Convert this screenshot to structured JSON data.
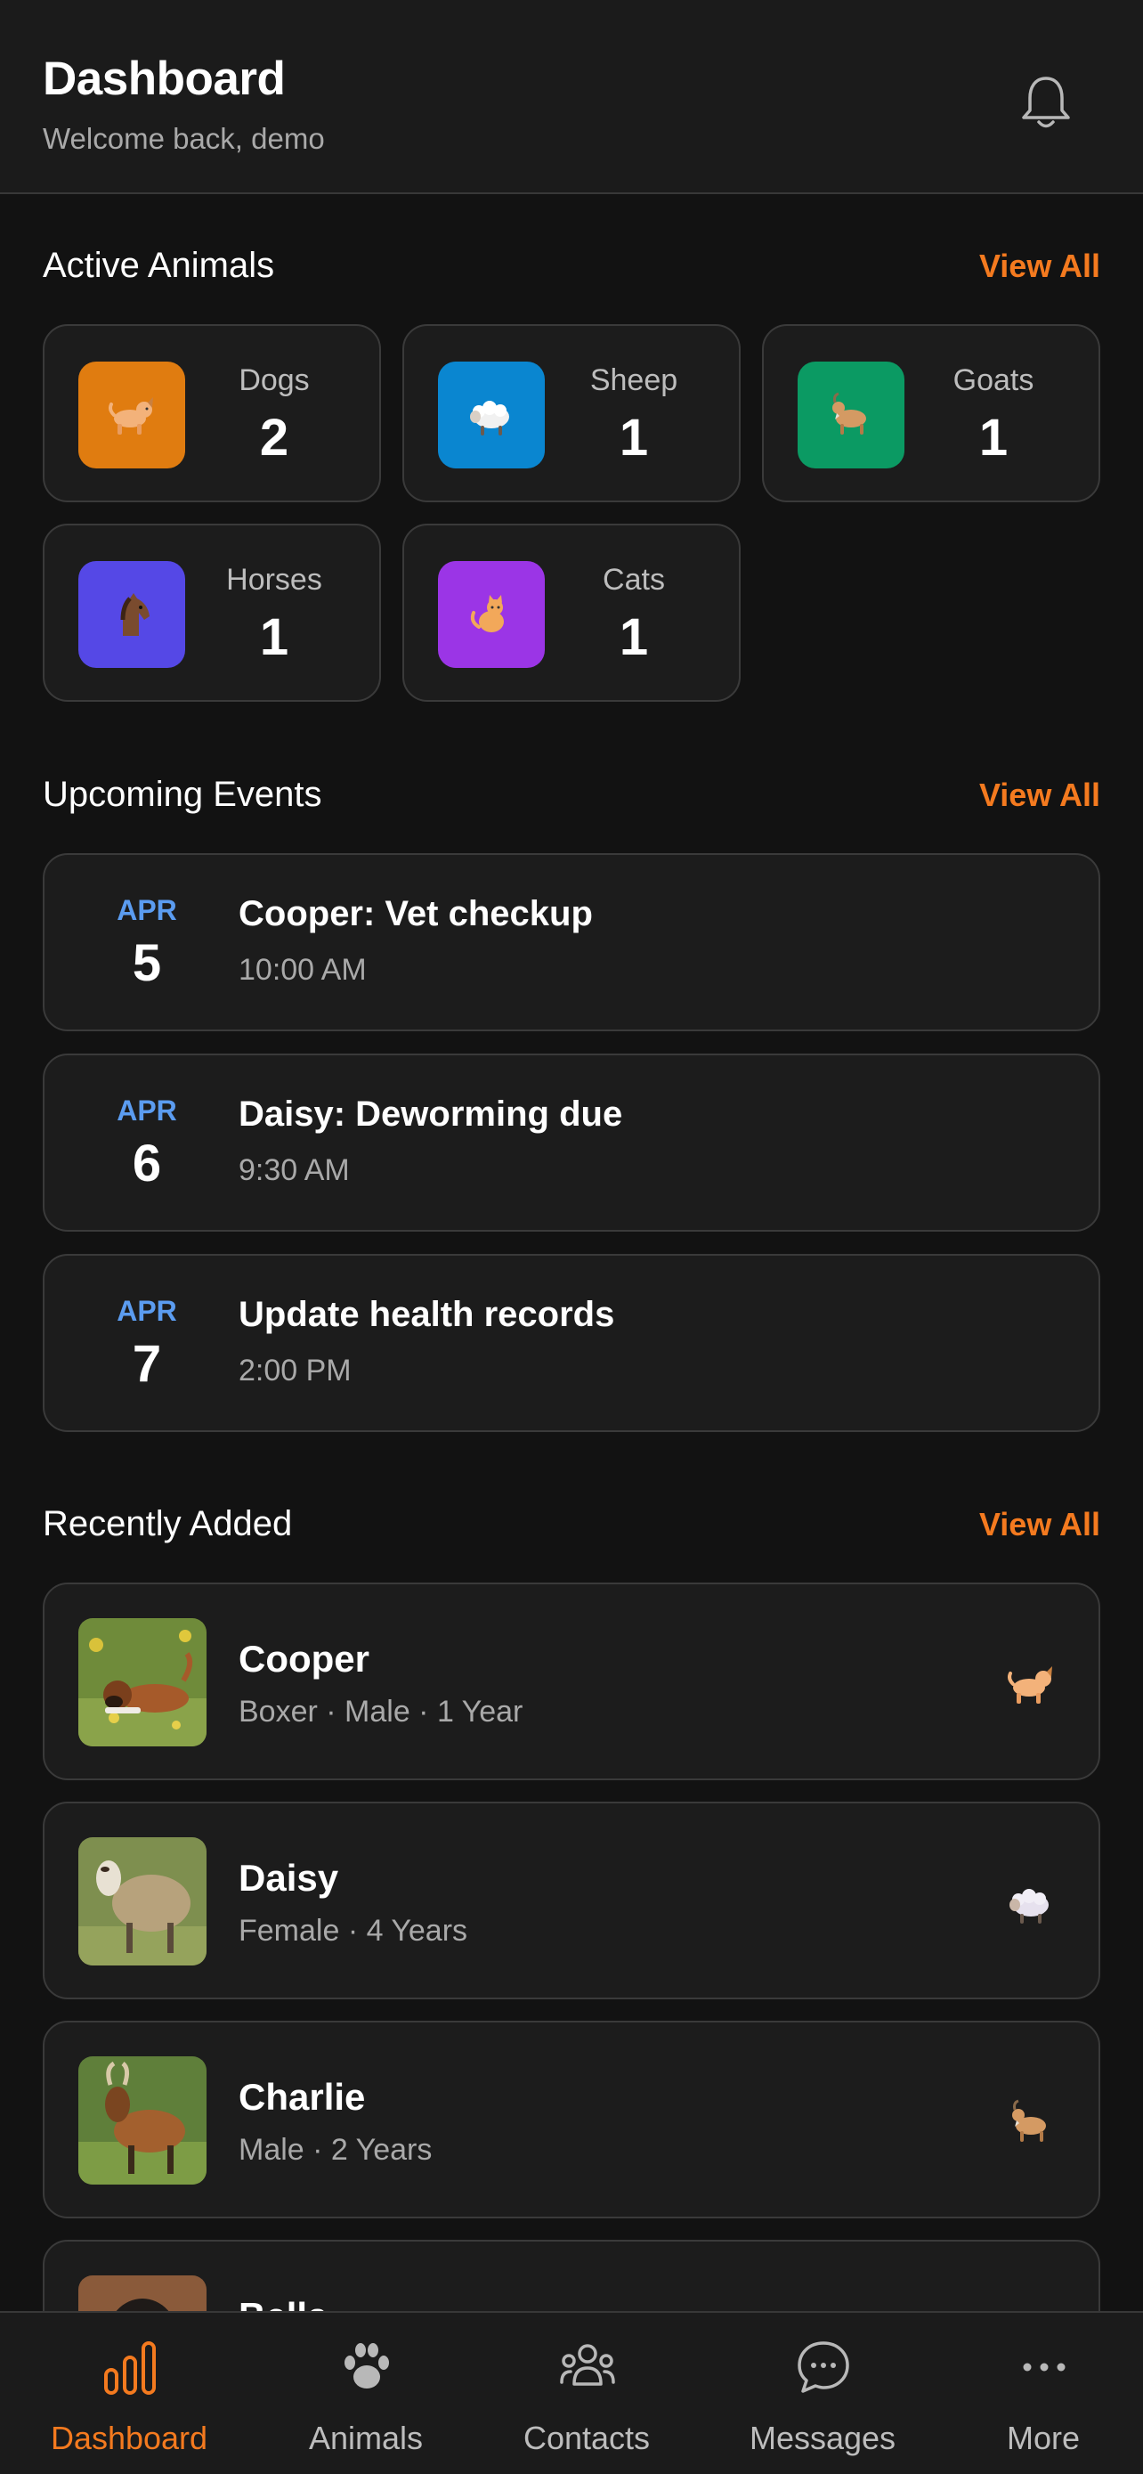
{
  "header": {
    "title": "Dashboard",
    "subtitle": "Welcome back, demo",
    "notification_icon": "bell-icon"
  },
  "active_animals": {
    "title": "Active Animals",
    "view_all": "View All",
    "categories": [
      {
        "label": "Dogs",
        "count": "2",
        "icon": "dog-icon",
        "color": "#e07c10"
      },
      {
        "label": "Sheep",
        "count": "1",
        "icon": "sheep-icon",
        "color": "#0a86d0"
      },
      {
        "label": "Goats",
        "count": "1",
        "icon": "goat-icon",
        "color": "#0b9a63"
      },
      {
        "label": "Horses",
        "count": "1",
        "icon": "horse-icon",
        "color": "#5548e6"
      },
      {
        "label": "Cats",
        "count": "1",
        "icon": "cat-icon",
        "color": "#9b35e6"
      }
    ]
  },
  "upcoming_events": {
    "title": "Upcoming Events",
    "view_all": "View All",
    "events": [
      {
        "month": "APR",
        "day": "5",
        "title": "Cooper: Vet checkup",
        "time": "10:00 AM"
      },
      {
        "month": "APR",
        "day": "6",
        "title": "Daisy: Deworming due",
        "time": "9:30 AM"
      },
      {
        "month": "APR",
        "day": "7",
        "title": "Update health records",
        "time": "2:00 PM"
      }
    ]
  },
  "recently_added": {
    "title": "Recently Added",
    "view_all": "View All",
    "animals": [
      {
        "name": "Cooper",
        "meta": "Boxer · Male · 1 Year",
        "species_icon": "dog-icon"
      },
      {
        "name": "Daisy",
        "meta": "Female · 4 Years",
        "species_icon": "sheep-icon"
      },
      {
        "name": "Charlie",
        "meta": "Male · 2 Years",
        "species_icon": "goat-icon"
      },
      {
        "name": "Bella",
        "meta": "",
        "species_icon": "dog-icon"
      }
    ]
  },
  "bottom_nav": {
    "active": "Dashboard",
    "accent": "#f47a1f",
    "items": [
      {
        "label": "Dashboard",
        "icon": "bar-chart-icon"
      },
      {
        "label": "Animals",
        "icon": "paw-icon"
      },
      {
        "label": "Contacts",
        "icon": "group-icon"
      },
      {
        "label": "Messages",
        "icon": "chat-bubble-icon"
      },
      {
        "label": "More",
        "icon": "more-dots-icon"
      }
    ]
  }
}
